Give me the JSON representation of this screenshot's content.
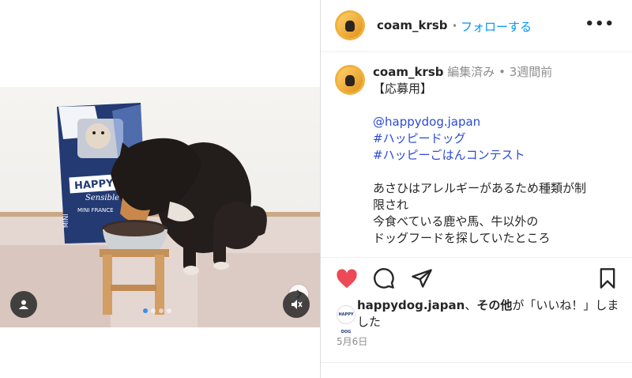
{
  "post": {
    "username": "coam_krsb",
    "follow_label": "フォローする",
    "separator": "•",
    "more_label": "•••",
    "edited_label": "編集済み",
    "time_ago": "3週間前",
    "caption_head": "【応募用】",
    "tags": [
      "@happydog.japan",
      "#ハッピードッグ",
      "#ハッピーごはんコンテスト"
    ],
    "caption_body": "あさひはアレルギーがあるため種類が制\n限され\n今食べている鹿や馬、牛以外の\nドッグフードを探していたところ\n手軽なドライフードを見つけました",
    "liked_by_user": "happydog.japan",
    "liked_by_suffix": "、",
    "liked_by_others": "その他",
    "liked_text": "が「いいね！」しました",
    "date": "5月6日"
  },
  "photo": {
    "bag_brand": "HAPPY DOG",
    "bag_line": "Sensible",
    "bag_variant": "MINI FRANCE",
    "bag_side": "MINI",
    "slides": 4,
    "active_slide": 0
  },
  "colors": {
    "like": "#ed4956",
    "link": "#0095f6",
    "muted": "#8e8e8e"
  }
}
